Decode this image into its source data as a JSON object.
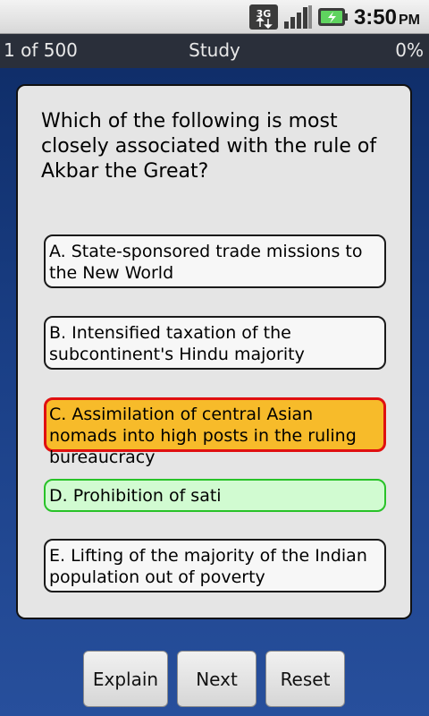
{
  "status_bar": {
    "network_label": "3G",
    "time": "3:50",
    "ampm": "PM",
    "icons": [
      "3g-data-icon",
      "signal-strength-icon",
      "battery-charging-icon"
    ]
  },
  "header": {
    "progress": "1 of 500",
    "mode": "Study",
    "percent": "0%"
  },
  "question": {
    "text": "Which of the following is most closely associated with the rule of Akbar the Great?",
    "answers": [
      {
        "label": "A. State-sponsored trade missions to the New World",
        "state": "default"
      },
      {
        "label": "B. Intensified taxation of the subcontinent's Hindu majority",
        "state": "default"
      },
      {
        "label": "C. Assimilation of central Asian nomads into high posts in the ruling bureaucracy",
        "state": "wrong"
      },
      {
        "label": "D. Prohibition of sati",
        "state": "correct"
      },
      {
        "label": "E. Lifting of the majority of the Indian population out of poverty",
        "state": "default"
      }
    ]
  },
  "buttons": {
    "explain": "Explain",
    "next": "Next",
    "reset": "Reset"
  },
  "colors": {
    "background": "#1a3f86",
    "wrong_fill": "#f7bb2a",
    "wrong_border": "#e01010",
    "correct_fill": "#d1fbd1",
    "correct_border": "#28c228"
  }
}
